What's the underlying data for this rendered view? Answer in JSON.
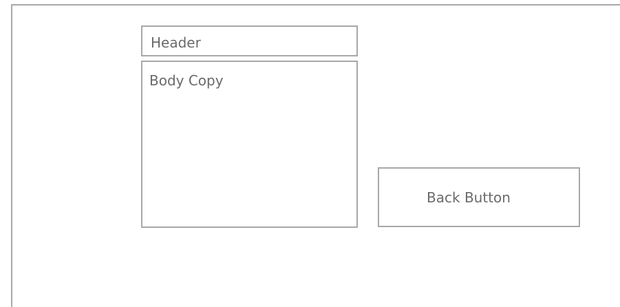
{
  "header": {
    "label": "Header"
  },
  "body": {
    "label": "Body Copy"
  },
  "back_button": {
    "label": "Back Button"
  }
}
